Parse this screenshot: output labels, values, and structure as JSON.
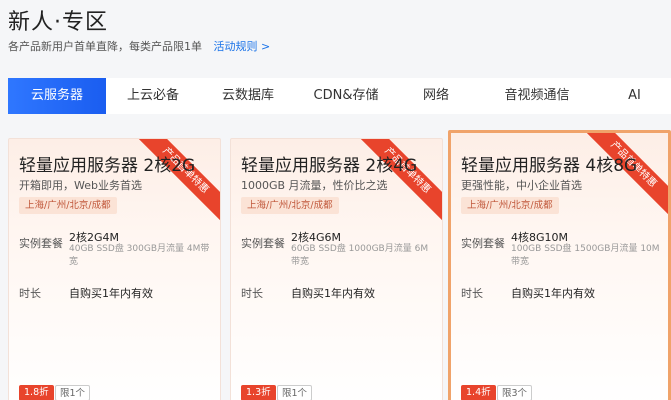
{
  "page": {
    "title": "新人·专区",
    "subtitle": "各产品新用户首单直降，每类产品限1单",
    "rules_link": "活动规则 >"
  },
  "tabs": [
    {
      "label": "云服务器",
      "active": true
    },
    {
      "label": "上云必备"
    },
    {
      "label": "云数据库"
    },
    {
      "label": "CDN&存储"
    },
    {
      "label": "网络"
    },
    {
      "label": "音视频通信"
    },
    {
      "label": "AI"
    }
  ],
  "spec_label": "实例套餐",
  "duration_label": "时长",
  "cards": [
    {
      "title": "轻量应用服务器 2核2G",
      "desc": "开箱即用，Web业务首选",
      "regions": "上海/广州/北京/成都",
      "spec": "2核2G4M",
      "spec_detail": "40GB SSD盘 300GB月流量 4M带宽",
      "duration": "自购买1年内有效",
      "discount": "1.8折",
      "limit": "限1个",
      "ribbon": "产品首单特惠"
    },
    {
      "title": "轻量应用服务器 2核4G",
      "desc": "1000GB 月流量，性价比之选",
      "regions": "上海/广州/北京/成都",
      "spec": "2核4G6M",
      "spec_detail": "60GB SSD盘 1000GB月流量 6M带宽",
      "duration": "自购买1年内有效",
      "discount": "1.3折",
      "limit": "限1个",
      "ribbon": "产品首单特惠"
    },
    {
      "title": "轻量应用服务器 4核8G",
      "desc": "更强性能，中小企业首选",
      "regions": "上海/广州/北京/成都",
      "spec": "4核8G10M",
      "spec_detail": "100GB SSD盘 1500GB月流量 10M带宽",
      "duration": "自购买1年内有效",
      "discount": "1.4折",
      "limit": "限3个",
      "ribbon": "产品首单特惠"
    }
  ],
  "colors": {
    "accent_blue": "#1a5df0",
    "promo_red": "#e8442c",
    "highlight_border": "#f0a36a"
  }
}
